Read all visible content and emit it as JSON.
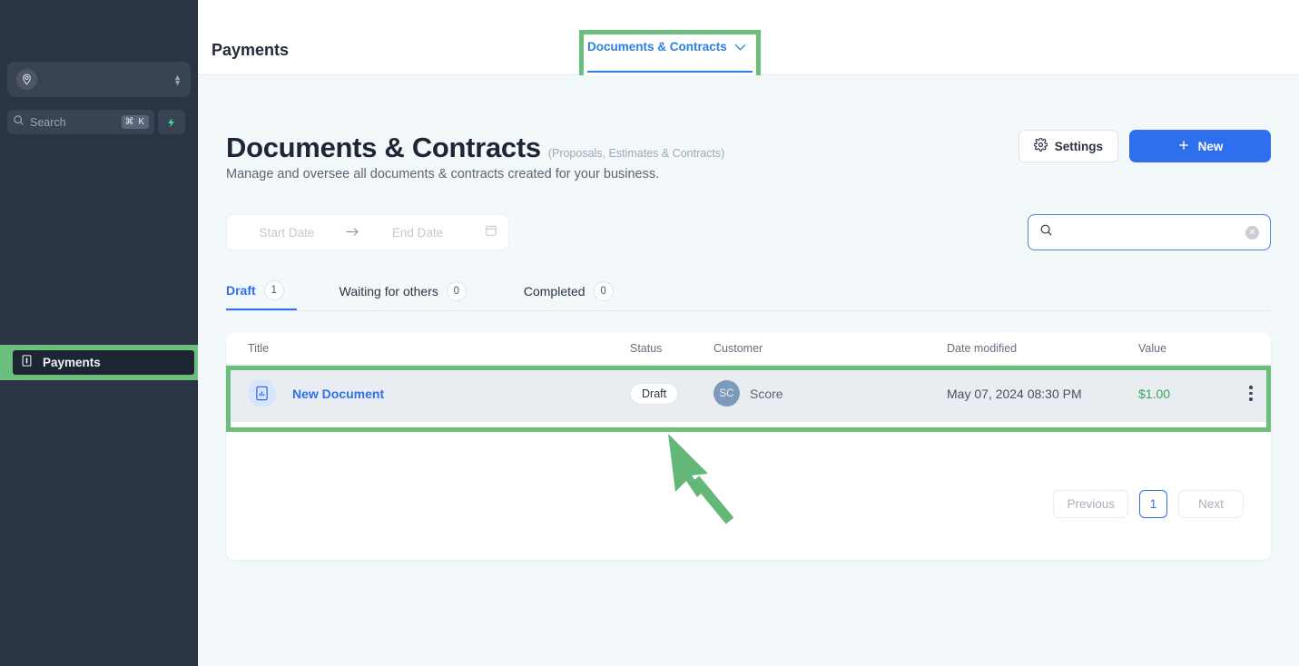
{
  "sidebar": {
    "org_switcher": {
      "icon": "location-pin-avatar-icon",
      "name": "",
      "stepper_icon": "chevron-up-down-icon"
    },
    "search": {
      "icon": "search-icon",
      "placeholder": "Search",
      "shortcut": "⌘ K",
      "spark_icon": "lightning-bolt-icon"
    },
    "nav_items": [
      {
        "label": "Payments",
        "icon": "bill-dollar-icon",
        "active": true
      }
    ]
  },
  "topbar": {
    "title": "Payments",
    "tab": {
      "label": "Documents & Contracts",
      "chevron": "chevron-down-icon"
    }
  },
  "page": {
    "title": "Documents & Contracts",
    "title_suffix": "(Proposals, Estimates & Contracts)",
    "description": "Manage and oversee all documents & contracts created for your business.",
    "settings_button": "Settings",
    "settings_icon": "gear-icon",
    "new_button": "New",
    "new_icon": "plus-icon"
  },
  "filters": {
    "start_date_placeholder": "Start Date",
    "end_date_placeholder": "End Date",
    "range_arrow_icon": "arrow-right-icon",
    "calendar_icon": "calendar-icon",
    "search": {
      "icon": "search-icon",
      "value": "",
      "placeholder": "",
      "clear_icon": "clear-circle-icon"
    }
  },
  "tabs": [
    {
      "label": "Draft",
      "count": "1",
      "active": true
    },
    {
      "label": "Waiting for others",
      "count": "0",
      "active": false
    },
    {
      "label": "Completed",
      "count": "0",
      "active": false
    }
  ],
  "table": {
    "columns": [
      "Title",
      "Status",
      "Customer",
      "Date modified",
      "Value"
    ],
    "rows": [
      {
        "icon": "document-chart-icon",
        "title": "New Document",
        "status": "Draft",
        "customer_initials": "SC",
        "customer": "Score",
        "date_modified": "May 07, 2024 08:30 PM",
        "value": "$1.00",
        "menu_icon": "kebab-menu-icon"
      }
    ]
  },
  "pagination": {
    "previous": "Previous",
    "current_page": "1",
    "next": "Next"
  },
  "annotations": {
    "highlight_color": "#6cbe7d",
    "cursor_icon": "arrow-cursor-annotation"
  },
  "colors": {
    "accent_blue": "#2f6fed",
    "sidebar_bg": "#2b3444",
    "page_bg": "#f3f8fa",
    "value_green": "#3aa65b"
  }
}
